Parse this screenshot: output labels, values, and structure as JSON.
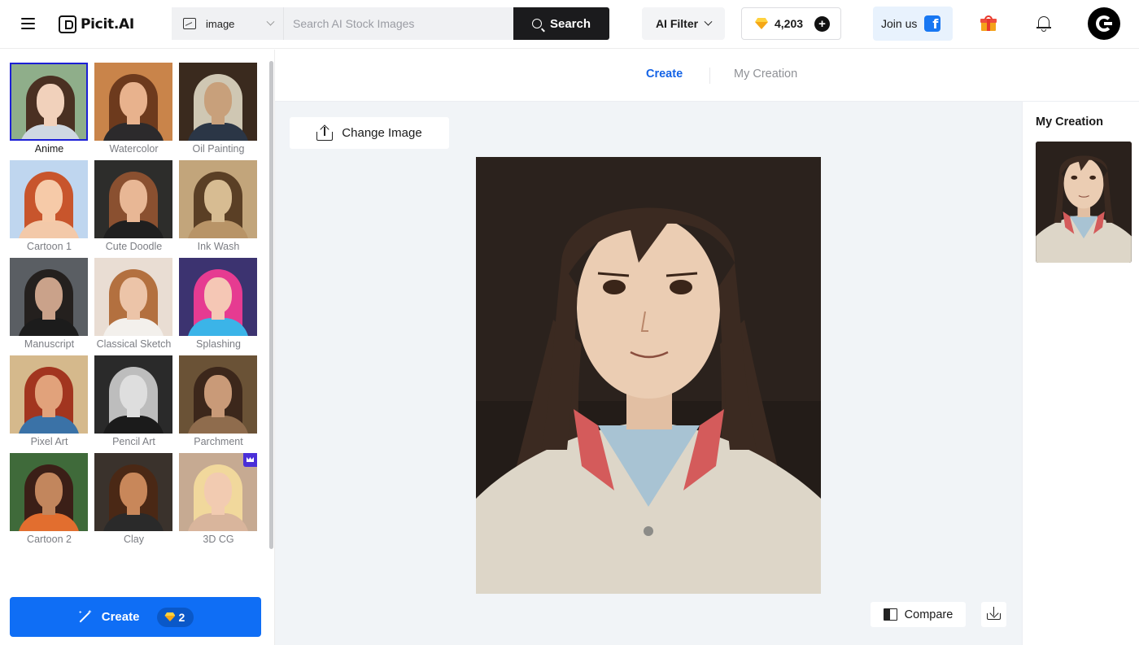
{
  "header": {
    "logo_text": "Picit.AI",
    "search_type": "image",
    "search_placeholder": "Search AI Stock Images",
    "search_button": "Search",
    "ai_filter": "AI Filter",
    "credits": "4,203",
    "join_us": "Join us",
    "facebook_glyph": "f"
  },
  "styles": [
    {
      "label": "Anime",
      "selected": true,
      "colors": {
        "bg": "#8fae8a",
        "hair": "#4a3022",
        "face": "#f1d1bb",
        "torso": "#cfd8e2"
      }
    },
    {
      "label": "Watercolor",
      "colors": {
        "bg": "#c9844a",
        "hair": "#6d3a1d",
        "face": "#e8b28d",
        "torso": "#2c2a2c"
      }
    },
    {
      "label": "Oil Painting",
      "colors": {
        "bg": "#3a2a1e",
        "hair": "#cfc7b3",
        "face": "#c8a07b",
        "torso": "#2b3646"
      }
    },
    {
      "label": "Cartoon 1",
      "colors": {
        "bg": "#bfd6ef",
        "hair": "#c8552c",
        "face": "#f6caa8",
        "torso": "#f3c9a9"
      }
    },
    {
      "label": "Cute Doodle",
      "colors": {
        "bg": "#2d2d2b",
        "hair": "#8a5030",
        "face": "#e8b795",
        "torso": "#1f1f1f"
      }
    },
    {
      "label": "Ink Wash",
      "colors": {
        "bg": "#c2a57b",
        "hair": "#5a3f25",
        "face": "#d7bc92",
        "torso": "#b89467"
      }
    },
    {
      "label": "Manuscript",
      "colors": {
        "bg": "#5a5e63",
        "hair": "#24201e",
        "face": "#caa28a",
        "torso": "#1c1c1c"
      }
    },
    {
      "label": "Classical Sketch",
      "colors": {
        "bg": "#e9ddd3",
        "hair": "#b3703f",
        "face": "#ecc4a8",
        "torso": "#f3f0ec"
      }
    },
    {
      "label": "Splashing",
      "colors": {
        "bg": "#3c3370",
        "hair": "#e63b91",
        "face": "#f5c7b5",
        "torso": "#3bb4e8"
      }
    },
    {
      "label": "Pixel Art",
      "colors": {
        "bg": "#d5b98c",
        "hair": "#a2351f",
        "face": "#e1a27b",
        "torso": "#3a72a7"
      }
    },
    {
      "label": "Pencil Art",
      "colors": {
        "bg": "#2a2a2a",
        "hair": "#bdbdbd",
        "face": "#dedede",
        "torso": "#1b1b1b"
      }
    },
    {
      "label": "Parchment",
      "colors": {
        "bg": "#6a5236",
        "hair": "#3c271b",
        "face": "#c99a78",
        "torso": "#8f6c4d"
      }
    },
    {
      "label": "Cartoon 2",
      "colors": {
        "bg": "#3f6a3a",
        "hair": "#3b1f17",
        "face": "#c2865d",
        "torso": "#e26e2f"
      }
    },
    {
      "label": "Clay",
      "colors": {
        "bg": "#3a322c",
        "hair": "#4a2815",
        "face": "#c8875a",
        "torso": "#2a2a2a"
      }
    },
    {
      "label": "3D CG",
      "premium": true,
      "colors": {
        "bg": "#c6aa92",
        "hair": "#f1d89c",
        "face": "#f2cbb1",
        "torso": "#d9b59c"
      }
    }
  ],
  "sidebar": {
    "create_label": "Create",
    "create_cost": "2"
  },
  "tabs": {
    "create": "Create",
    "my_creation": "My Creation"
  },
  "workspace": {
    "change_image": "Change Image",
    "compare": "Compare"
  },
  "right_panel": {
    "title": "My Creation"
  },
  "colors": {
    "primary_blue": "#0f6ef5",
    "tab_active": "#1463e6",
    "selected_border": "#1c1fd6",
    "search_button_bg": "#1b1b1d"
  }
}
